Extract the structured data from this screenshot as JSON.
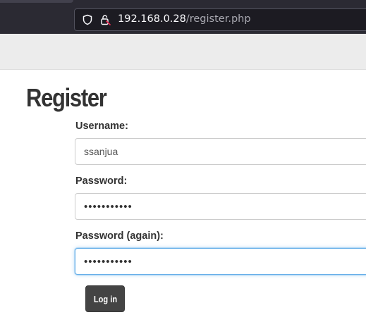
{
  "browser": {
    "url_host": "192.168.0.28",
    "url_path": "/register.php",
    "icons": [
      "shield-icon",
      "insecure-lock-icon"
    ]
  },
  "page": {
    "title": "Register"
  },
  "form": {
    "username_label": "Username:",
    "username_value": "ssanjua",
    "password_label": "Password:",
    "password_value": "•••••••••••",
    "password_again_label": "Password (again):",
    "password_again_value": "•••••••••••",
    "submit_label": "Log in"
  },
  "colors": {
    "focus_ring": "#66afe9",
    "button_bg": "#444444",
    "insecure_lock": "#e22850"
  }
}
